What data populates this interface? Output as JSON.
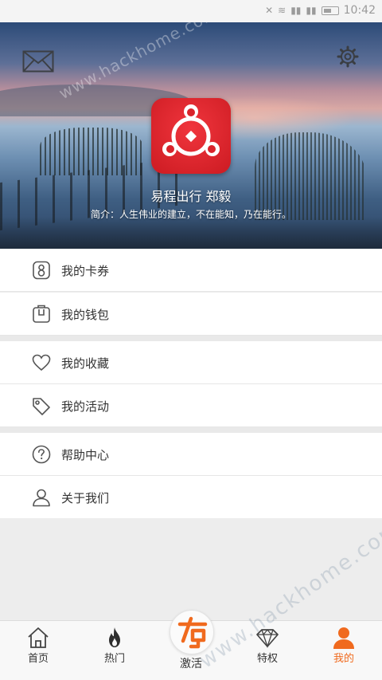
{
  "status_bar": {
    "time": "10:42"
  },
  "header": {
    "username": "易程出行 郑毅",
    "bio": "简介：人生伟业的建立，不在能知，乃在能行。"
  },
  "menu": {
    "coupons": "我的卡券",
    "wallet": "我的钱包",
    "favorites": "我的收藏",
    "activities": "我的活动",
    "help": "帮助中心",
    "about": "关于我们"
  },
  "tabs": {
    "home": "首页",
    "hot": "热门",
    "activate": "激活",
    "privileges": "特权",
    "mine": "我的"
  },
  "watermark": "www.hackhome.com",
  "colors": {
    "accent": "#f06a1e",
    "logo_red": "#e3262e"
  }
}
